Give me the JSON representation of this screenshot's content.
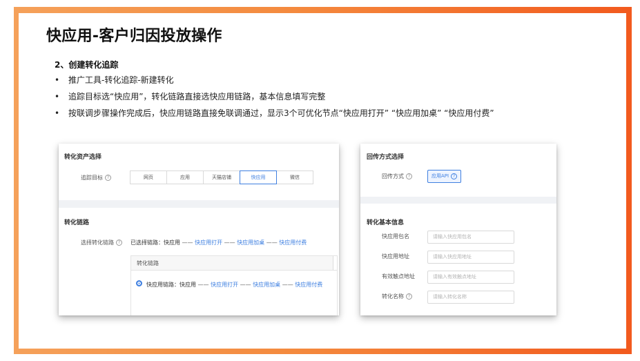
{
  "slide": {
    "title": "快应用-客户归因投放操作",
    "subhead": "2、创建转化追踪",
    "bullets": [
      "推广工具-转化追踪-新建转化",
      "追踪目标选“快应用”，转化链路直接选快应用链路，基本信息填写完整",
      "按联调步骤操作完成后，快应用链路直接免联调通过，显示3个可优化节点“快应用打开” “快应用加桌” “快应用付费”"
    ],
    "bullet_glyph": "•"
  },
  "left_panel": {
    "asset_section_title": "转化资产选择",
    "target_label": "追踪目标",
    "target_options": [
      "网页",
      "应用",
      "天猫店铺",
      "快应用",
      "微信"
    ],
    "target_selected": "快应用",
    "chain_section_title": "转化链路",
    "select_chain_label": "选择转化链路",
    "selected_chain": {
      "prefix": "已选择链路：",
      "start": "快应用",
      "steps": [
        "快应用打开",
        "快应用加桌",
        "快应用付费"
      ],
      "dash": "——"
    },
    "chain_box": {
      "header": "转化链路",
      "option_prefix": "快应用链路：",
      "start": "快应用",
      "steps": [
        "快应用打开",
        "快应用加桌",
        "快应用付费"
      ],
      "dash": "——"
    }
  },
  "right_panel": {
    "callback_section_title": "回传方式选择",
    "callback_label": "回传方式",
    "callback_button": "应用API",
    "basic_section_title": "转化基本信息",
    "fields": [
      {
        "label": "快应用包名",
        "placeholder": "请输入快应用包名",
        "help": false
      },
      {
        "label": "快应用地址",
        "placeholder": "请输入快应用地址",
        "help": false
      },
      {
        "label": "有效触点地址",
        "placeholder": "请输入有效触点地址",
        "help": false
      },
      {
        "label": "转化名称",
        "placeholder": "请输入转化名称",
        "help": true
      }
    ]
  },
  "icons": {
    "help": "help-circle-icon",
    "radio": "radio-selected-icon",
    "help_glyph": "?"
  },
  "colors": {
    "accent": "#3e7fe0",
    "frame_start": "#f5a15a",
    "frame_end": "#f25a1e"
  }
}
